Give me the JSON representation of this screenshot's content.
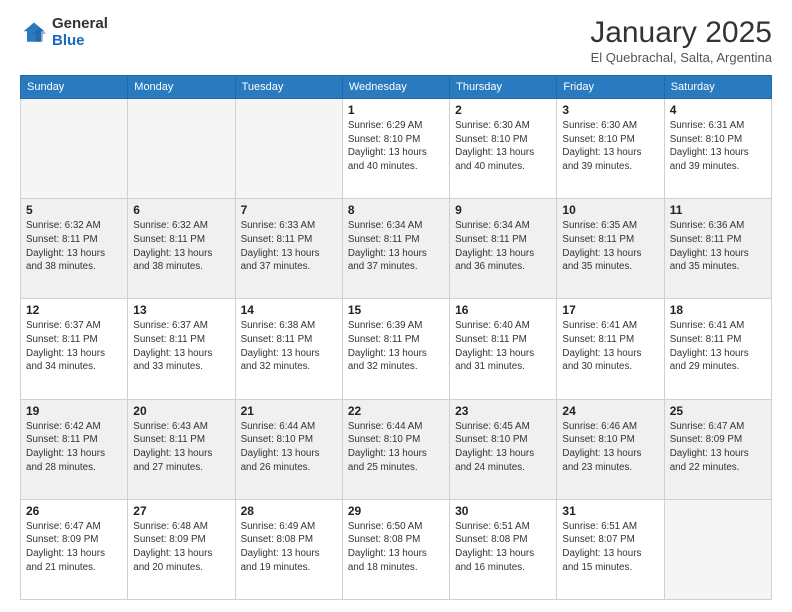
{
  "logo": {
    "general": "General",
    "blue": "Blue"
  },
  "header": {
    "month": "January 2025",
    "location": "El Quebrachal, Salta, Argentina"
  },
  "weekdays": [
    "Sunday",
    "Monday",
    "Tuesday",
    "Wednesday",
    "Thursday",
    "Friday",
    "Saturday"
  ],
  "days": [
    {
      "num": "",
      "info": ""
    },
    {
      "num": "",
      "info": ""
    },
    {
      "num": "",
      "info": ""
    },
    {
      "num": "1",
      "info": "Sunrise: 6:29 AM\nSunset: 8:10 PM\nDaylight: 13 hours\nand 40 minutes."
    },
    {
      "num": "2",
      "info": "Sunrise: 6:30 AM\nSunset: 8:10 PM\nDaylight: 13 hours\nand 40 minutes."
    },
    {
      "num": "3",
      "info": "Sunrise: 6:30 AM\nSunset: 8:10 PM\nDaylight: 13 hours\nand 39 minutes."
    },
    {
      "num": "4",
      "info": "Sunrise: 6:31 AM\nSunset: 8:10 PM\nDaylight: 13 hours\nand 39 minutes."
    },
    {
      "num": "5",
      "info": "Sunrise: 6:32 AM\nSunset: 8:11 PM\nDaylight: 13 hours\nand 38 minutes."
    },
    {
      "num": "6",
      "info": "Sunrise: 6:32 AM\nSunset: 8:11 PM\nDaylight: 13 hours\nand 38 minutes."
    },
    {
      "num": "7",
      "info": "Sunrise: 6:33 AM\nSunset: 8:11 PM\nDaylight: 13 hours\nand 37 minutes."
    },
    {
      "num": "8",
      "info": "Sunrise: 6:34 AM\nSunset: 8:11 PM\nDaylight: 13 hours\nand 37 minutes."
    },
    {
      "num": "9",
      "info": "Sunrise: 6:34 AM\nSunset: 8:11 PM\nDaylight: 13 hours\nand 36 minutes."
    },
    {
      "num": "10",
      "info": "Sunrise: 6:35 AM\nSunset: 8:11 PM\nDaylight: 13 hours\nand 35 minutes."
    },
    {
      "num": "11",
      "info": "Sunrise: 6:36 AM\nSunset: 8:11 PM\nDaylight: 13 hours\nand 35 minutes."
    },
    {
      "num": "12",
      "info": "Sunrise: 6:37 AM\nSunset: 8:11 PM\nDaylight: 13 hours\nand 34 minutes."
    },
    {
      "num": "13",
      "info": "Sunrise: 6:37 AM\nSunset: 8:11 PM\nDaylight: 13 hours\nand 33 minutes."
    },
    {
      "num": "14",
      "info": "Sunrise: 6:38 AM\nSunset: 8:11 PM\nDaylight: 13 hours\nand 32 minutes."
    },
    {
      "num": "15",
      "info": "Sunrise: 6:39 AM\nSunset: 8:11 PM\nDaylight: 13 hours\nand 32 minutes."
    },
    {
      "num": "16",
      "info": "Sunrise: 6:40 AM\nSunset: 8:11 PM\nDaylight: 13 hours\nand 31 minutes."
    },
    {
      "num": "17",
      "info": "Sunrise: 6:41 AM\nSunset: 8:11 PM\nDaylight: 13 hours\nand 30 minutes."
    },
    {
      "num": "18",
      "info": "Sunrise: 6:41 AM\nSunset: 8:11 PM\nDaylight: 13 hours\nand 29 minutes."
    },
    {
      "num": "19",
      "info": "Sunrise: 6:42 AM\nSunset: 8:11 PM\nDaylight: 13 hours\nand 28 minutes."
    },
    {
      "num": "20",
      "info": "Sunrise: 6:43 AM\nSunset: 8:11 PM\nDaylight: 13 hours\nand 27 minutes."
    },
    {
      "num": "21",
      "info": "Sunrise: 6:44 AM\nSunset: 8:10 PM\nDaylight: 13 hours\nand 26 minutes."
    },
    {
      "num": "22",
      "info": "Sunrise: 6:44 AM\nSunset: 8:10 PM\nDaylight: 13 hours\nand 25 minutes."
    },
    {
      "num": "23",
      "info": "Sunrise: 6:45 AM\nSunset: 8:10 PM\nDaylight: 13 hours\nand 24 minutes."
    },
    {
      "num": "24",
      "info": "Sunrise: 6:46 AM\nSunset: 8:10 PM\nDaylight: 13 hours\nand 23 minutes."
    },
    {
      "num": "25",
      "info": "Sunrise: 6:47 AM\nSunset: 8:09 PM\nDaylight: 13 hours\nand 22 minutes."
    },
    {
      "num": "26",
      "info": "Sunrise: 6:47 AM\nSunset: 8:09 PM\nDaylight: 13 hours\nand 21 minutes."
    },
    {
      "num": "27",
      "info": "Sunrise: 6:48 AM\nSunset: 8:09 PM\nDaylight: 13 hours\nand 20 minutes."
    },
    {
      "num": "28",
      "info": "Sunrise: 6:49 AM\nSunset: 8:08 PM\nDaylight: 13 hours\nand 19 minutes."
    },
    {
      "num": "29",
      "info": "Sunrise: 6:50 AM\nSunset: 8:08 PM\nDaylight: 13 hours\nand 18 minutes."
    },
    {
      "num": "30",
      "info": "Sunrise: 6:51 AM\nSunset: 8:08 PM\nDaylight: 13 hours\nand 16 minutes."
    },
    {
      "num": "31",
      "info": "Sunrise: 6:51 AM\nSunset: 8:07 PM\nDaylight: 13 hours\nand 15 minutes."
    },
    {
      "num": "",
      "info": ""
    }
  ]
}
